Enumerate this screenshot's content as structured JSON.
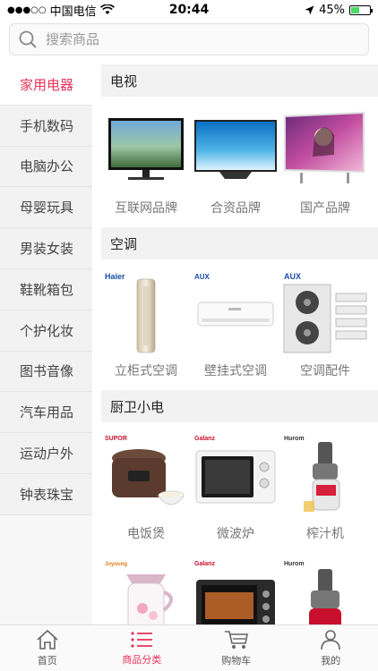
{
  "status_bar": {
    "signal": "●●●○○",
    "carrier": "中国电信",
    "time": "20:44",
    "battery": "45%"
  },
  "search": {
    "placeholder": "搜索商品"
  },
  "sidebar": {
    "items": [
      {
        "label": "家用电器"
      },
      {
        "label": "手机数码"
      },
      {
        "label": "电脑办公"
      },
      {
        "label": "母婴玩具"
      },
      {
        "label": "男装女装"
      },
      {
        "label": "鞋靴箱包"
      },
      {
        "label": "个护化妆"
      },
      {
        "label": "图书音像"
      },
      {
        "label": "汽车用品"
      },
      {
        "label": "运动户外"
      },
      {
        "label": "钟表珠宝"
      }
    ]
  },
  "sections": [
    {
      "title": "电视",
      "items": [
        {
          "label": "互联网品牌",
          "brand": ""
        },
        {
          "label": "合资品牌",
          "brand": ""
        },
        {
          "label": "国产品牌",
          "brand": ""
        }
      ]
    },
    {
      "title": "空调",
      "items": [
        {
          "label": "立柜式空调",
          "brand": "Haier"
        },
        {
          "label": "壁挂式空调",
          "brand": "AUX"
        },
        {
          "label": "空调配件",
          "brand": "AUX"
        }
      ]
    },
    {
      "title": "厨卫小电",
      "items": [
        {
          "label": "电饭煲",
          "brand": "SUPOR"
        },
        {
          "label": "微波炉",
          "brand": "Galanz"
        },
        {
          "label": "榨汁机",
          "brand": "Hurom"
        },
        {
          "label": "",
          "brand": "Joyoung"
        },
        {
          "label": "",
          "brand": "Galanz"
        },
        {
          "label": "",
          "brand": "Hurom"
        }
      ]
    }
  ],
  "tabs": [
    {
      "label": "首页",
      "icon": "home-icon"
    },
    {
      "label": "商品分类",
      "icon": "list-icon"
    },
    {
      "label": "购物车",
      "icon": "cart-icon"
    },
    {
      "label": "我的",
      "icon": "user-icon"
    }
  ],
  "colors": {
    "accent": "#e6335a"
  }
}
